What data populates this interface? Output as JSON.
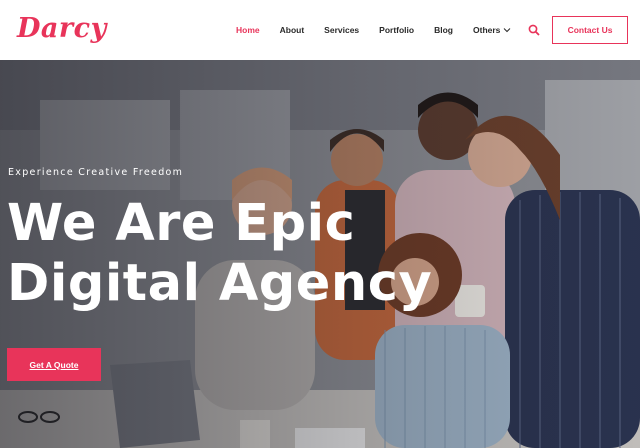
{
  "brand": {
    "logo_text": "Darcy",
    "accent_color": "#e8345a"
  },
  "nav": {
    "items": [
      {
        "label": "Home",
        "active": true
      },
      {
        "label": "About",
        "active": false
      },
      {
        "label": "Services",
        "active": false
      },
      {
        "label": "Portfolio",
        "active": false
      },
      {
        "label": "Blog",
        "active": false
      },
      {
        "label": "Others",
        "active": false,
        "has_dropdown": true
      }
    ],
    "search_icon": "search-icon",
    "contact_label": "Contact Us"
  },
  "hero": {
    "kicker": "Experience Creative Freedom",
    "headline_line1": "We Are Epic",
    "headline_line2": "Digital Agency",
    "cta_label": "Get A Quote"
  }
}
